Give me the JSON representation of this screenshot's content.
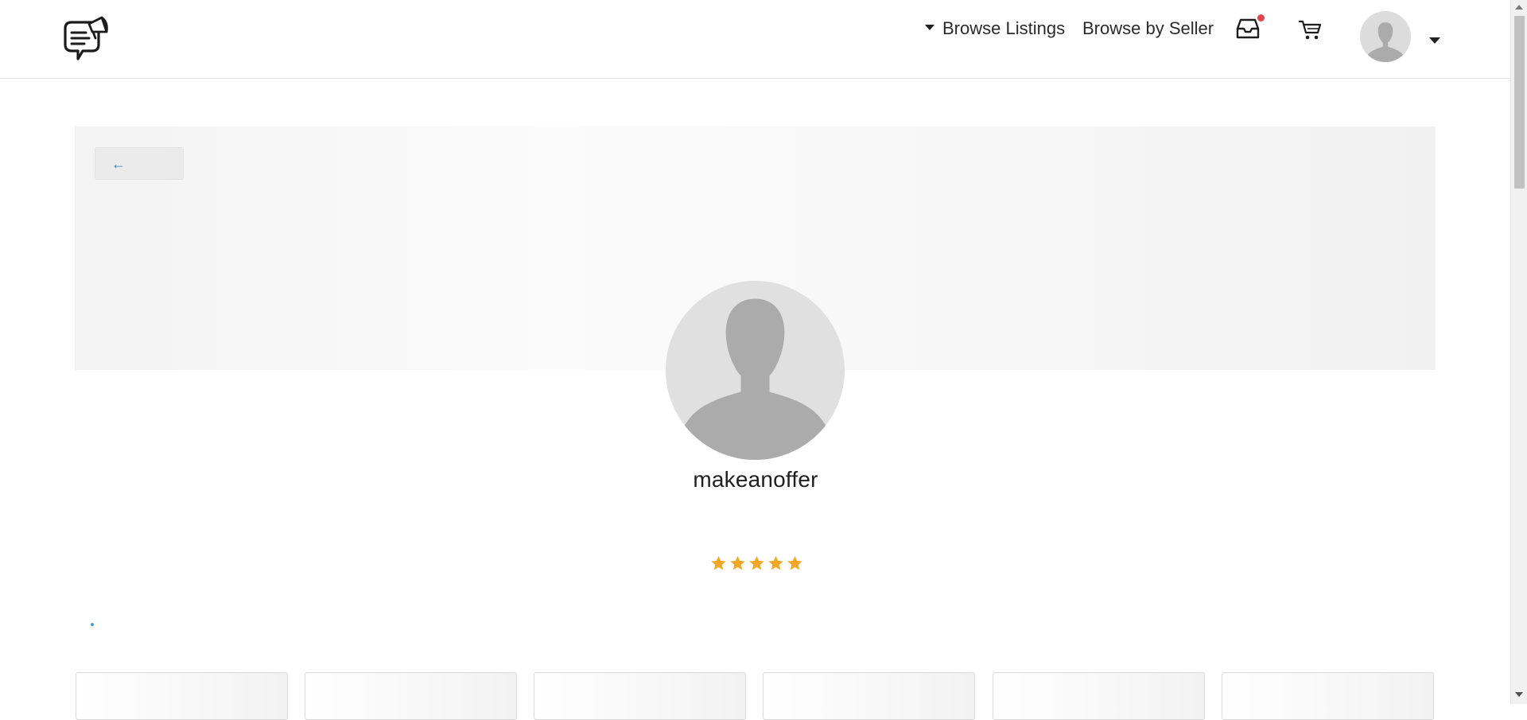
{
  "header": {
    "logo_icon": "chat-megaphone-logo-icon",
    "nav": {
      "browse_listings": "Browse Listings",
      "browse_by_seller": "Browse by Seller"
    },
    "inbox_icon": "inbox-tray-icon",
    "cart_icon": "shopping-cart-icon",
    "notification_color": "#e8424a"
  },
  "banner": {
    "back_label": "←"
  },
  "profile": {
    "username": "makeanoffer",
    "rating": 5,
    "rating_max": 5,
    "star_color": "#f5a623"
  },
  "cards": [
    {
      "placeholder": ""
    },
    {
      "placeholder": ""
    },
    {
      "placeholder": ""
    },
    {
      "placeholder": ""
    },
    {
      "placeholder": ""
    },
    {
      "placeholder": ""
    }
  ]
}
